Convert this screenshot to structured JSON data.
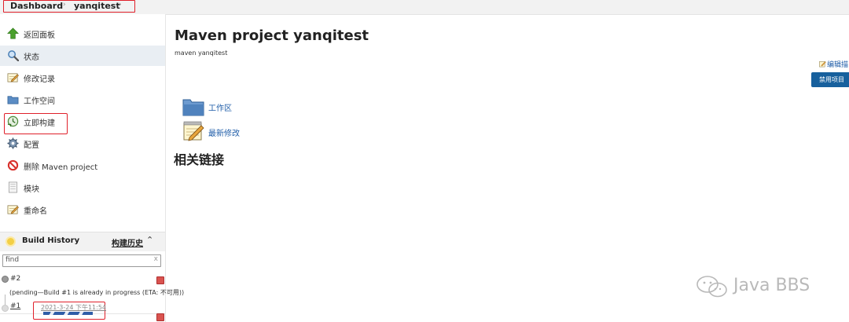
{
  "breadcrumb": {
    "items": [
      "Dashboard",
      "yanqitest"
    ]
  },
  "sidebar": {
    "tasks": [
      {
        "label": "返回面板",
        "icon": "up-arrow-icon"
      },
      {
        "label": "状态",
        "icon": "magnifier-icon"
      },
      {
        "label": "修改记录",
        "icon": "notepad-icon"
      },
      {
        "label": "工作空间",
        "icon": "folder-icon"
      },
      {
        "label": "立即构建",
        "icon": "build-now-icon"
      },
      {
        "label": "配置",
        "icon": "gear-icon"
      },
      {
        "label": "删除 Maven project",
        "icon": "no-entry-icon"
      },
      {
        "label": "模块",
        "icon": "document-icon"
      },
      {
        "label": "重命名",
        "icon": "notepad-icon"
      }
    ],
    "active_task": "状态",
    "build_history": {
      "title": "Build History",
      "trend_label": "构建历史",
      "search_placeholder": "find",
      "clear_glyph": "x",
      "builds": [
        {
          "number": "#2",
          "status": "(pending—Build #1 is already in progress (ETA: 不可用))"
        },
        {
          "number": "#1",
          "date": "2021-3-24 下午11:54",
          "in_progress": true
        }
      ]
    }
  },
  "main": {
    "title": "Maven project yanqitest",
    "description": "maven yanqitest",
    "edit_description_label": "编辑描",
    "disable_button_label": "禁用项目",
    "links": [
      {
        "label": "工作区",
        "icon": "folder-icon"
      },
      {
        "label": "最新修改",
        "icon": "notepad-icon"
      }
    ],
    "related_links_heading": "相关链接"
  },
  "watermark": {
    "text": "Java BBS"
  },
  "colors": {
    "accent_link": "#1f5da8",
    "button_bg": "#17609d",
    "highlight_border": "#e0202a",
    "active_row_bg": "#e9eef3"
  }
}
